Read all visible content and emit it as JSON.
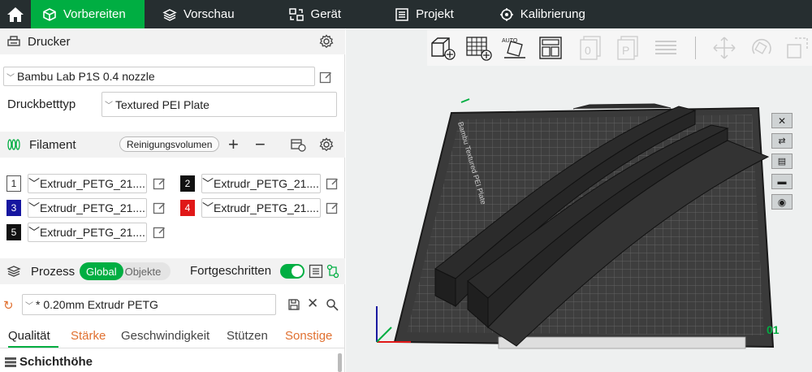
{
  "topbar": {
    "tabs": [
      {
        "label": "Vorbereiten"
      },
      {
        "label": "Vorschau"
      },
      {
        "label": "Gerät"
      },
      {
        "label": "Projekt"
      },
      {
        "label": "Kalibrierung"
      }
    ]
  },
  "printer": {
    "section_title": "Drucker",
    "selected_printer": "Bambu Lab P1S 0.4 nozzle",
    "bed_label": "Druckbetttyp",
    "bed_value": "Textured PEI Plate"
  },
  "filament": {
    "section_title": "Filament",
    "flush_button": "Reinigungsvolumen",
    "slots": [
      {
        "num": "1",
        "value": "Extrudr_PETG_21....",
        "color": "#ffffff",
        "text_color": "#222222"
      },
      {
        "num": "2",
        "value": "Extrudr_PETG_21....",
        "color": "#111111",
        "text_color": "#ffffff"
      },
      {
        "num": "3",
        "value": "Extrudr_PETG_21....",
        "color": "#1616a0",
        "text_color": "#ffffff"
      },
      {
        "num": "4",
        "value": "Extrudr_PETG_21....",
        "color": "#e01818",
        "text_color": "#ffffff"
      },
      {
        "num": "5",
        "value": "Extrudr_PETG_21....",
        "color": "#111111",
        "text_color": "#ffffff"
      }
    ]
  },
  "process": {
    "section_title": "Prozess",
    "toggle_global": "Global",
    "toggle_objects": "Objekte",
    "advanced_label": "Fortgeschritten",
    "preset_value": "* 0.20mm Extrudr PETG",
    "tabs": [
      {
        "label": "Qualität",
        "color": "#222222"
      },
      {
        "label": "Stärke",
        "color": "#e07030"
      },
      {
        "label": "Geschwindigkeit",
        "color": "#444444"
      },
      {
        "label": "Stützen",
        "color": "#444444"
      },
      {
        "label": "Sonstige",
        "color": "#e07030"
      }
    ],
    "group_title": "Schichthöhe"
  },
  "viewport": {
    "plate_label": "Bambu Textured PEI Plate",
    "plate_number": "01"
  },
  "colors": {
    "accent": "#00ae42",
    "topbar": "#262e30"
  }
}
